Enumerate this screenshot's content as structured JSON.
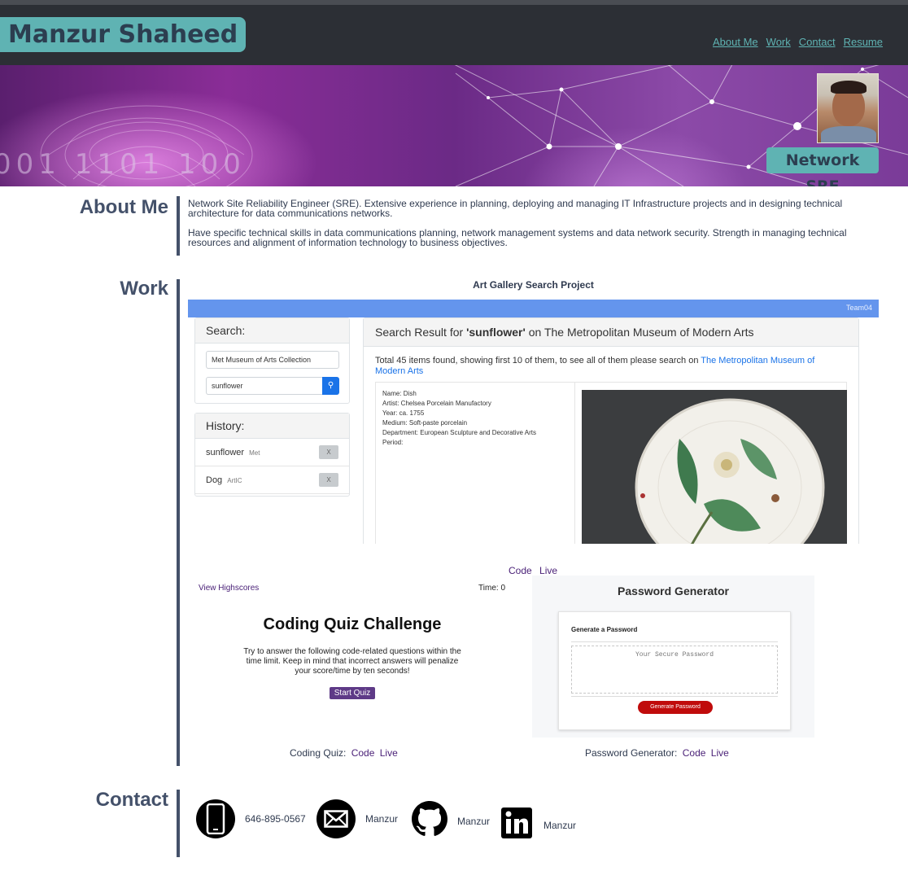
{
  "header": {
    "name": "Manzur Shaheed",
    "nav": [
      "About Me",
      "Work",
      "Contact",
      "Resume"
    ]
  },
  "hero": {
    "role": "Network SRE",
    "banner_text": "001 1101 100"
  },
  "about": {
    "title": "About Me",
    "paragraphs": [
      "Network Site Reliability Engineer (SRE). Extensive experience in planning, deploying and managing IT Infrastructure projects and in designing technical architecture for data communications networks.",
      "Have specific technical skills in data communications planning, network management systems and data network security. Strength in managing technical resources and alignment of information technology to business objectives."
    ]
  },
  "work": {
    "title": "Work",
    "art_gallery": {
      "project_title": "Art Gallery Search Project",
      "team": "Team04",
      "search_label": "Search:",
      "select_value": "Met Museum of Arts Collection",
      "search_value": "sunflower",
      "history_label": "History:",
      "history": [
        {
          "term": "sunflower",
          "source": "Met",
          "remove": "X"
        },
        {
          "term": "Dog",
          "source": "ArtIC",
          "remove": "X"
        }
      ],
      "result_prefix": "Search Result for ",
      "result_term": "'sunflower'",
      "result_suffix": " on The Metropolitan Museum of Modern Arts",
      "summary": "Total 45 items found, showing first 10 of them, to see all of them please search on ",
      "summary_link": "The Metropolitan Museum of Modern Arts",
      "item": {
        "name": "Name: Dish",
        "artist": "Artist: Chelsea Porcelain Manufactory",
        "year": "Year: ca. 1755",
        "medium": "Medium: Soft-paste porcelain",
        "department": "Department: European Sculpture and Decorative Arts",
        "period": "Period:"
      },
      "code": "Code",
      "live": "Live"
    },
    "quiz": {
      "highscores": "View Highscores",
      "time": "Time: 0",
      "title": "Coding Quiz Challenge",
      "description": "Try to answer the following code-related questions within the time limit. Keep in mind that incorrect answers will penalize your score/time by ten seconds!",
      "start": "Start Quiz",
      "caption": "Coding Quiz:",
      "code": "Code",
      "live": "Live"
    },
    "password": {
      "title": "Password Generator",
      "card_title": "Generate a Password",
      "placeholder": "Your Secure Password",
      "button": "Generate Password",
      "caption": "Password Generator:",
      "code": "Code",
      "live": "Live"
    }
  },
  "contact": {
    "title": "Contact",
    "items": [
      {
        "icon": "phone-icon",
        "label": "646-895-0567"
      },
      {
        "icon": "mail-icon",
        "label": "Manzur"
      },
      {
        "icon": "github-icon",
        "label": "Manzur"
      },
      {
        "icon": "linkedin-icon",
        "label": "Manzur"
      }
    ]
  },
  "colors": {
    "header_bg": "#2c2f35",
    "accent": "#5fb3b3",
    "section_title": "#44516a",
    "link_visited": "#4b2278"
  }
}
